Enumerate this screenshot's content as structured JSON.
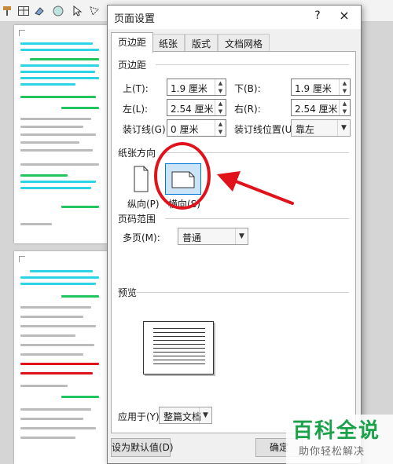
{
  "dialog": {
    "title": "页面设置",
    "help_label": "?",
    "close_label": "×",
    "tabs": [
      {
        "label": "页边距",
        "active": true
      },
      {
        "label": "纸张",
        "active": false
      },
      {
        "label": "版式",
        "active": false
      },
      {
        "label": "文档网格",
        "active": false
      }
    ],
    "margins": {
      "section_title": "页边距",
      "top_label": "上(T):",
      "top_value": "1.9 厘米",
      "bottom_label": "下(B):",
      "bottom_value": "1.9 厘米",
      "left_label": "左(L):",
      "left_value": "2.54 厘米",
      "right_label": "右(R):",
      "right_value": "2.54 厘米",
      "gutter_label": "装订线(G):",
      "gutter_value": "0 厘米",
      "gutter_pos_label": "装订线位置(U):",
      "gutter_pos_value": "靠左"
    },
    "orientation": {
      "section_title": "纸张方向",
      "portrait_label": "纵向(P)",
      "landscape_label": "横向(S)",
      "selected": "landscape"
    },
    "pages": {
      "section_title": "页码范围",
      "multiple_label": "多页(M):",
      "multiple_value": "普通"
    },
    "preview": {
      "section_title": "预览"
    },
    "apply": {
      "label": "应用于(Y):",
      "value": "整篇文档"
    },
    "buttons": {
      "default_label": "设为默认值(D)",
      "ok_label": "确定"
    }
  },
  "watermark": {
    "brand": "百科全说",
    "slogan": "助你轻松解决"
  },
  "colors": {
    "accent": "#0078d7",
    "annotation": "#e0131b",
    "highlight_green": "#22c55e",
    "highlight_cyan": "#2dd4e6",
    "watermark_green": "#1aa24a"
  }
}
